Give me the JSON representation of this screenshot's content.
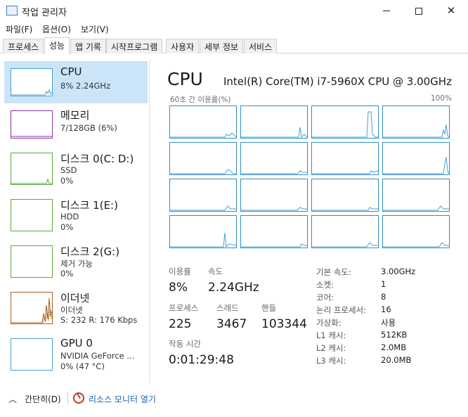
{
  "window": {
    "title": "작업 관리자"
  },
  "menu": [
    "파일(F)",
    "옵션(O)",
    "보기(V)"
  ],
  "tabs": [
    "프로세스",
    "성능",
    "앱 기록",
    "시작프로그램",
    "사용자",
    "세부 정보",
    "서비스"
  ],
  "sidebar": {
    "items": [
      {
        "name": "CPU",
        "sub1": "8% 2.24GHz",
        "sub2": "",
        "sub3": "",
        "color": "#4ba0cf"
      },
      {
        "name": "메모리",
        "sub1": "7/128GB (6%)",
        "sub2": "",
        "sub3": "",
        "color": "#8b2fa0"
      },
      {
        "name": "디스크 0(C: D:)",
        "sub1": "SSD",
        "sub2": "0%",
        "sub3": "",
        "color": "#5aaa3a"
      },
      {
        "name": "디스크 1(E:)",
        "sub1": "HDD",
        "sub2": "0%",
        "sub3": "",
        "color": "#5aaa3a"
      },
      {
        "name": "디스크 2(G:)",
        "sub1": "제거 가능",
        "sub2": "0%",
        "sub3": "",
        "color": "#5aaa3a"
      },
      {
        "name": "이더넷",
        "sub1": "이더넷",
        "sub2": "S: 232  R: 176 Kbps",
        "sub3": "",
        "color": "#a8621f"
      },
      {
        "name": "GPU 0",
        "sub1": "NVIDIA GeForce ...",
        "sub2": "0% (47 °C)",
        "sub3": "",
        "color": "#4ba0cf"
      }
    ]
  },
  "cpu": {
    "title": "CPU",
    "model": "Intel(R) Core(TM) i7-5960X CPU @ 3.00GHz",
    "graph_label_left": "60초 간 이용률(%)",
    "graph_label_right": "100%",
    "stats": {
      "usage_label": "이용률",
      "usage_value": "8%",
      "speed_label": "속도",
      "speed_value": "2.24GHz",
      "process_label": "프로세스",
      "process_value": "225",
      "thread_label": "스레드",
      "thread_value": "3467",
      "handle_label": "핸들",
      "handle_value": "103344",
      "uptime_label": "작동 시간",
      "uptime_value": "0:01:29:48"
    },
    "specs": [
      {
        "label": "기본 속도:",
        "value": "3.00GHz"
      },
      {
        "label": "소켓:",
        "value": "1"
      },
      {
        "label": "코어:",
        "value": "8"
      },
      {
        "label": "논리 프로세서:",
        "value": "16"
      },
      {
        "label": "가상화:",
        "value": "사용"
      },
      {
        "label": "L1 캐시:",
        "value": "512KB"
      },
      {
        "label": "L2 캐시:",
        "value": "2.0MB"
      },
      {
        "label": "L3 캐시:",
        "value": "20.0MB"
      }
    ]
  },
  "footer": {
    "fold_label": "간단히(D)",
    "monitor_label": "리소스 모니터 열기"
  },
  "colors": {
    "accent": "#4ba0cf",
    "selected_bg": "#cce4f7",
    "link": "#1a5fb4"
  }
}
